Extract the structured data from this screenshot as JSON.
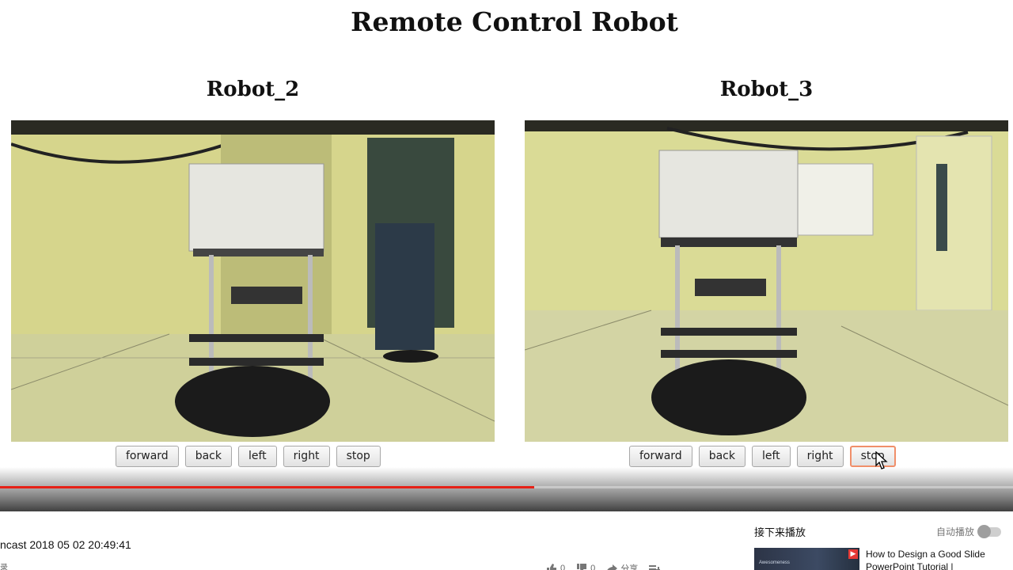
{
  "video": {
    "title": "Remote Control Robot",
    "robots": [
      {
        "name": "Robot_2",
        "buttons": [
          "forward",
          "back",
          "left",
          "right",
          "stop"
        ]
      },
      {
        "name": "Robot_3",
        "buttons": [
          "forward",
          "back",
          "left",
          "right",
          "stop"
        ]
      }
    ],
    "progress_fraction": 0.527,
    "colors": {
      "progress": "#e62117",
      "button_focus": "#f08f6a"
    }
  },
  "below": {
    "meta_text": "ncast 2018 05 02 20:49:41",
    "meta_sub": "录",
    "actions": [
      {
        "icon": "thumbs-up-icon",
        "label": "0"
      },
      {
        "icon": "thumbs-down-icon",
        "label": "0"
      },
      {
        "icon": "share-icon",
        "label": "分享"
      },
      {
        "icon": "add-to-playlist-icon",
        "label": ""
      }
    ]
  },
  "sidebar": {
    "up_next": "接下来播放",
    "autoplay_label": "自动播放",
    "autoplay_on": false,
    "recommended": [
      {
        "title": "How to Design a Good Slide PowerPoint Tutorial |",
        "thumb_text": "Awesomeness"
      }
    ]
  }
}
